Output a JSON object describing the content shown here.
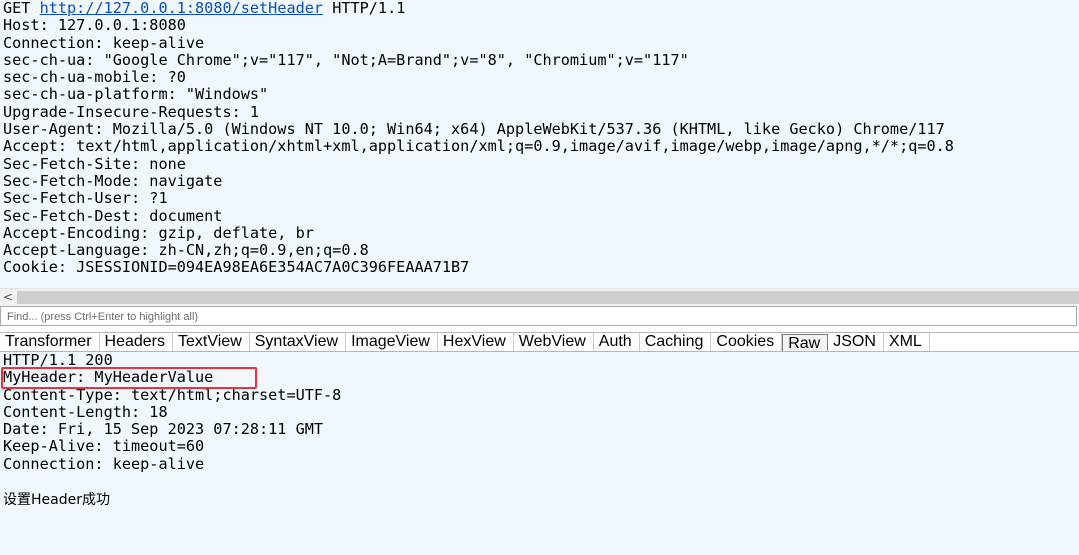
{
  "request": {
    "method": "GET",
    "url": "http://127.0.0.1:8080/setHeader",
    "protocol": "HTTP/1.1",
    "headers": [
      "Host: 127.0.0.1:8080",
      "Connection: keep-alive",
      "sec-ch-ua: \"Google Chrome\";v=\"117\", \"Not;A=Brand\";v=\"8\", \"Chromium\";v=\"117\"",
      "sec-ch-ua-mobile: ?0",
      "sec-ch-ua-platform: \"Windows\"",
      "Upgrade-Insecure-Requests: 1",
      "User-Agent: Mozilla/5.0 (Windows NT 10.0; Win64; x64) AppleWebKit/537.36 (KHTML, like Gecko) Chrome/117",
      "Accept: text/html,application/xhtml+xml,application/xml;q=0.9,image/avif,image/webp,image/apng,*/*;q=0.8",
      "Sec-Fetch-Site: none",
      "Sec-Fetch-Mode: navigate",
      "Sec-Fetch-User: ?1",
      "Sec-Fetch-Dest: document",
      "Accept-Encoding: gzip, deflate, br",
      "Accept-Language: zh-CN,zh;q=0.9,en;q=0.8",
      "Cookie: JSESSIONID=094EA98EA6E354AC7A0C396FEAAA71B7"
    ]
  },
  "scrollbar": {
    "left_arrow": "<"
  },
  "find": {
    "placeholder": "Find... (press Ctrl+Enter to highlight all)"
  },
  "response_tabs": [
    "Transformer",
    "Headers",
    "TextView",
    "SyntaxView",
    "ImageView",
    "HexView",
    "WebView",
    "Auth",
    "Caching",
    "Cookies",
    "Raw",
    "JSON",
    "XML"
  ],
  "active_tab": "Raw",
  "response": {
    "status_line": "HTTP/1.1 200",
    "highlighted_header": "MyHeader: MyHeaderValue",
    "headers": [
      "Content-Type: text/html;charset=UTF-8",
      "Content-Length: 18",
      "Date: Fri, 15 Sep 2023 07:28:11 GMT",
      "Keep-Alive: timeout=60",
      "Connection: keep-alive"
    ],
    "body": "设置Header成功"
  },
  "colors": {
    "highlight_border": "#e8333c",
    "link": "#0a4fc2",
    "pane_background": "#f0f8fd"
  }
}
